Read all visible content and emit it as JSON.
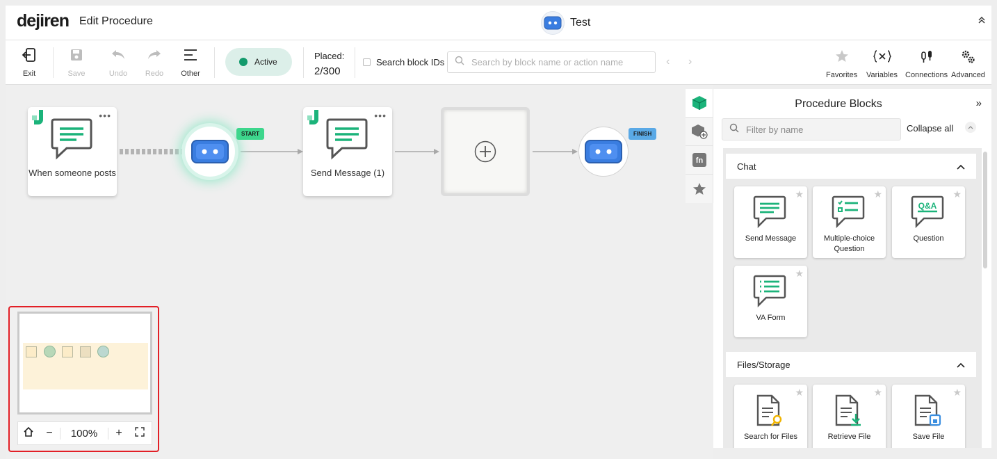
{
  "app": {
    "logo": "dejiren",
    "page_title": "Edit Procedure",
    "bot_name": "Test",
    "collapse_icon": "double-chevron-up-icon"
  },
  "toolbar": {
    "exit_label": "Exit",
    "save_label": "Save",
    "undo_label": "Undo",
    "redo_label": "Redo",
    "other_label": "Other",
    "status_label": "Active",
    "status_color": "#139a6c",
    "placed_label": "Placed:",
    "placed_count": "2/300",
    "search_ids_label": "Search block IDs",
    "search_placeholder": "Search by block name or action name",
    "prev_arrow": "‹",
    "next_arrow": "›",
    "favorites_label": "Favorites",
    "variables_label": "Variables",
    "connections_label": "Connections",
    "advanced_label": "Advanced"
  },
  "canvas": {
    "nodes": [
      {
        "label": "When someone posts",
        "type": "trigger"
      },
      {
        "label": "",
        "type": "start-bot",
        "tag": "START"
      },
      {
        "label": "Send Message (1)",
        "type": "action"
      },
      {
        "label": "",
        "type": "add-block"
      },
      {
        "label": "",
        "type": "finish-bot",
        "tag": "FINISH"
      }
    ],
    "more_glyph": "•••"
  },
  "minimap": {
    "zoom": "100%",
    "home_icon": "home-icon",
    "zoom_out": "−",
    "zoom_in": "+",
    "fit_icon": "fit-screen-icon"
  },
  "side_tabs": [
    "blocks-cube-icon",
    "add-package-icon",
    "function-icon",
    "star-icon"
  ],
  "side_tab_fn": "fn",
  "panel": {
    "title": "Procedure Blocks",
    "expand_glyph": "»",
    "filter_placeholder": "Filter by name",
    "collapse_all": "Collapse all",
    "categories": [
      {
        "name": "Chat",
        "blocks": [
          {
            "label": "Send Message"
          },
          {
            "label": "Multiple-choice Question"
          },
          {
            "label": "Question"
          },
          {
            "label": "VA Form"
          }
        ]
      },
      {
        "name": "Files/Storage",
        "blocks": [
          {
            "label": "Search for Files"
          },
          {
            "label": "Retrieve File"
          },
          {
            "label": "Save File"
          }
        ]
      }
    ],
    "qa_text": "Q&A"
  },
  "colors": {
    "brand_green": "#1bb37a",
    "bot_blue": "#3a7de0",
    "highlight_red": "#e21f26"
  }
}
